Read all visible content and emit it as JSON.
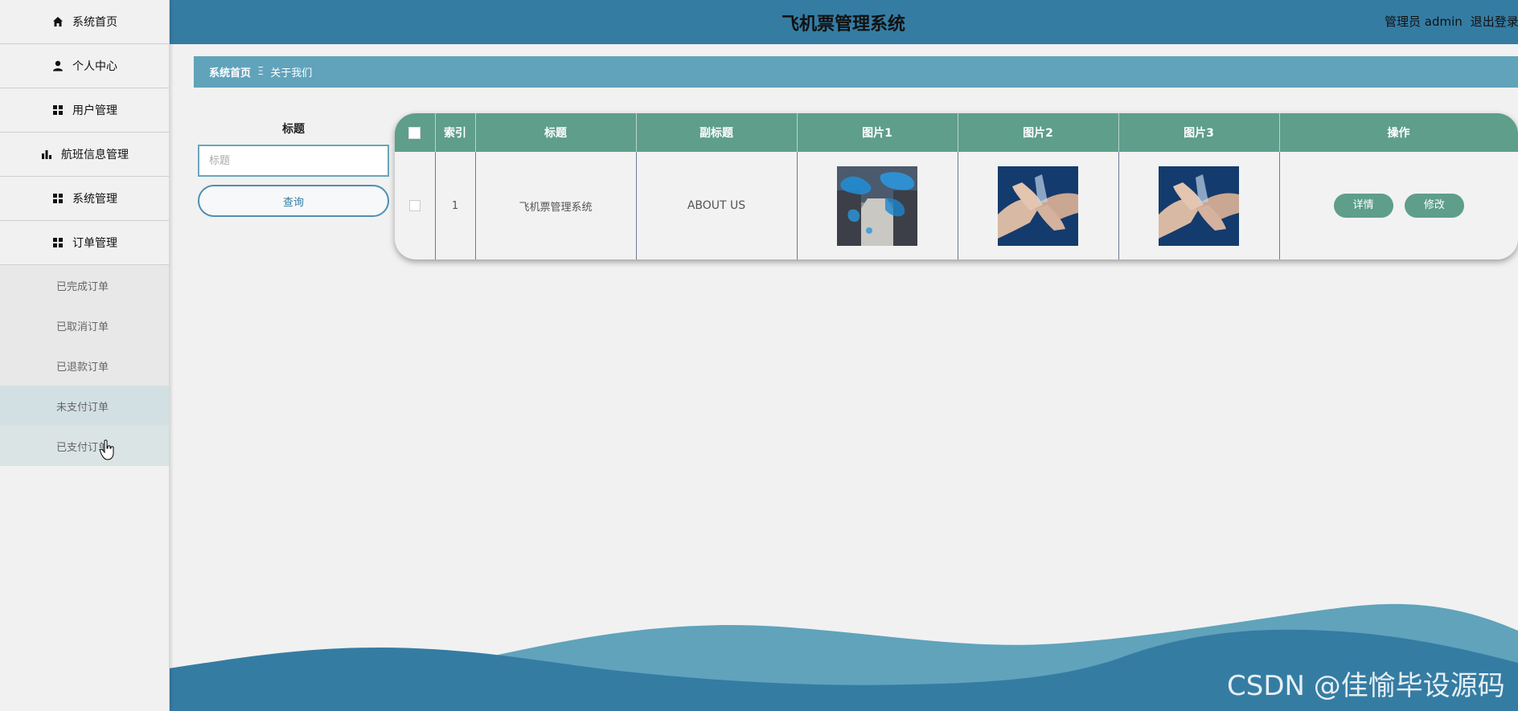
{
  "header": {
    "title": "飞机票管理系统",
    "user_label": "管理员 admin",
    "logout_label": "退出登录"
  },
  "sidebar": {
    "items": [
      {
        "label": "系统首页",
        "icon": "home-icon"
      },
      {
        "label": "个人中心",
        "icon": "user-icon"
      },
      {
        "label": "用户管理",
        "icon": "grid-icon"
      },
      {
        "label": "航班信息管理",
        "icon": "bar-chart-icon"
      },
      {
        "label": "系统管理",
        "icon": "grid-icon"
      },
      {
        "label": "订单管理",
        "icon": "grid-icon"
      }
    ],
    "subitems": [
      {
        "label": "已完成订单"
      },
      {
        "label": "已取消订单"
      },
      {
        "label": "已退款订单"
      },
      {
        "label": "未支付订单"
      },
      {
        "label": "已支付订单"
      }
    ]
  },
  "breadcrumb": {
    "home": "系统首页",
    "separator": "Ξ",
    "current": "关于我们"
  },
  "search": {
    "label": "标题",
    "placeholder": "标题",
    "value": "",
    "button": "查询"
  },
  "table": {
    "headers": [
      "索引",
      "标题",
      "副标题",
      "图片1",
      "图片2",
      "图片3",
      "操作"
    ],
    "rows": [
      {
        "index": "1",
        "title": "飞机票管理系统",
        "subtitle": "ABOUT US",
        "image1": "warehouse-map-photo",
        "image2": "hands-together-photo",
        "image3": "hands-together-photo",
        "actions": [
          "详情",
          "修改"
        ]
      }
    ]
  },
  "watermark": "CSDN @佳愉毕设源码",
  "colors": {
    "header": "#357ca3",
    "breadcrumb": "#60a3bb",
    "table_header": "#5e9e8a",
    "wave_dark": "#357ca3",
    "wave_light": "#60a3bb"
  }
}
